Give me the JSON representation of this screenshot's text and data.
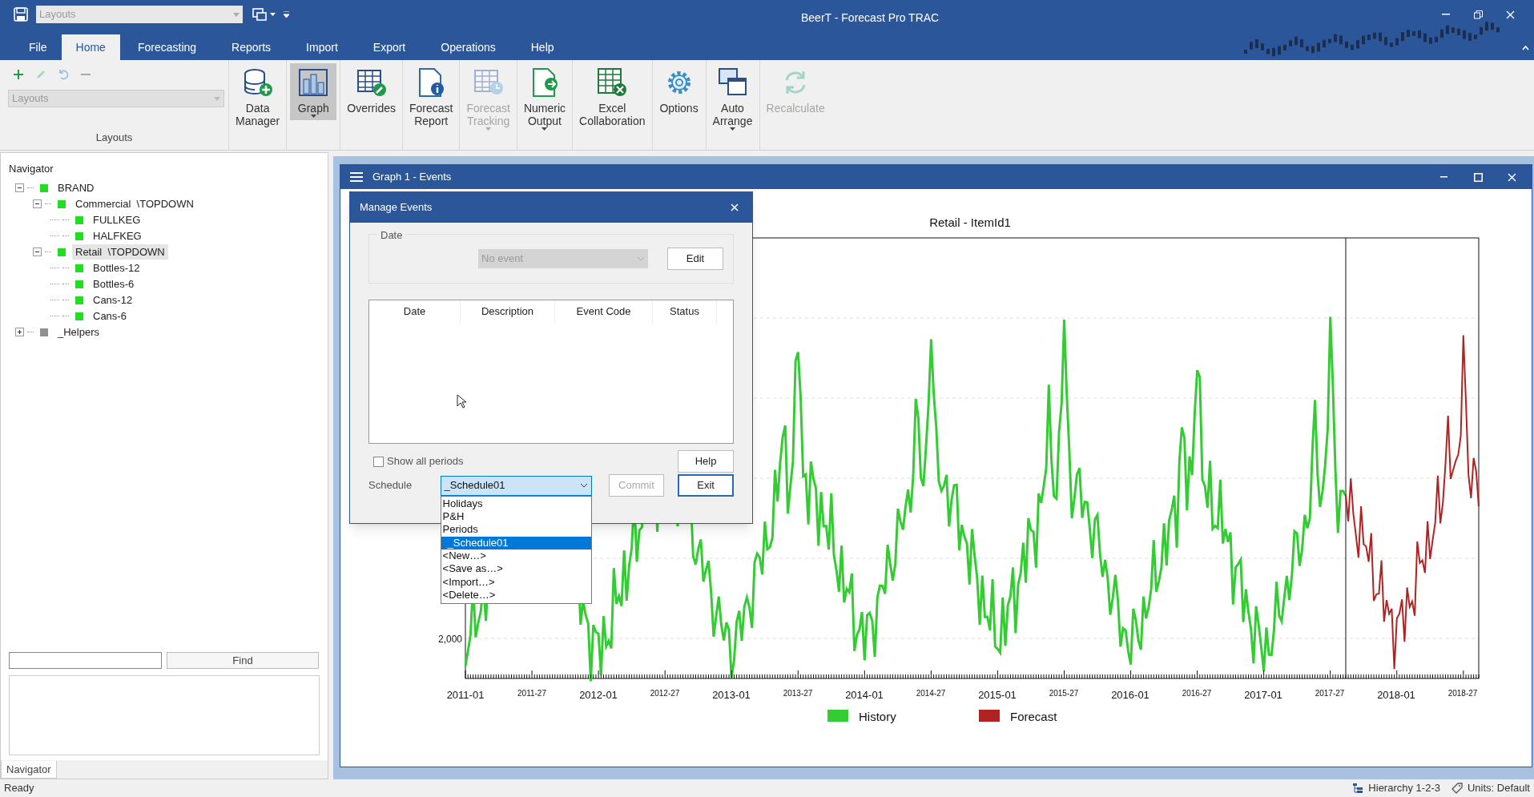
{
  "title_bar": {
    "layouts_combo": "Layouts",
    "title": "BeerT - Forecast Pro TRAC"
  },
  "ribbon_tabs": [
    {
      "label": "File",
      "selected": false
    },
    {
      "label": "Home",
      "selected": true
    },
    {
      "label": "Forecasting",
      "selected": false
    },
    {
      "label": "Reports",
      "selected": false
    },
    {
      "label": "Import",
      "selected": false
    },
    {
      "label": "Export",
      "selected": false
    },
    {
      "label": "Operations",
      "selected": false
    },
    {
      "label": "Help",
      "selected": false
    }
  ],
  "layouts_group": {
    "combo": "Layouts",
    "label": "Layouts"
  },
  "ribbon_buttons": [
    {
      "lines": [
        "Data",
        "Manager"
      ],
      "disabled": false,
      "selected": false,
      "has_menu": false
    },
    {
      "lines": [
        "Graph"
      ],
      "disabled": false,
      "selected": true,
      "has_menu": true
    },
    {
      "lines": [
        "Overrides"
      ],
      "disabled": false,
      "selected": false,
      "has_menu": false
    },
    {
      "lines": [
        "Forecast",
        "Report"
      ],
      "disabled": false,
      "selected": false,
      "has_menu": false
    },
    {
      "lines": [
        "Forecast",
        "Tracking"
      ],
      "disabled": true,
      "selected": false,
      "has_menu": true
    },
    {
      "lines": [
        "Numeric",
        "Output"
      ],
      "disabled": false,
      "selected": false,
      "has_menu": true
    },
    {
      "lines": [
        "Excel",
        "Collaboration"
      ],
      "disabled": false,
      "selected": false,
      "has_menu": false
    },
    {
      "lines": [
        "Options"
      ],
      "disabled": false,
      "selected": false,
      "has_menu": false
    },
    {
      "lines": [
        "Auto",
        "Arrange"
      ],
      "disabled": false,
      "selected": false,
      "has_menu": true
    },
    {
      "lines": [
        "Recalculate"
      ],
      "disabled": true,
      "selected": false,
      "has_menu": false
    }
  ],
  "navigator": {
    "title": "Navigator",
    "tree": [
      {
        "label": "BRAND",
        "color": "#22dd22",
        "expanded": true,
        "selected": false,
        "children": [
          {
            "label": "Commercial  \\TOPDOWN",
            "color": "#22dd22",
            "expanded": true,
            "selected": false,
            "children": [
              {
                "label": "FULLKEG",
                "color": "#22dd22",
                "selected": false
              },
              {
                "label": "HALFKEG",
                "color": "#22dd22",
                "selected": false
              }
            ]
          },
          {
            "label": "Retail  \\TOPDOWN",
            "color": "#22dd22",
            "expanded": true,
            "selected": true,
            "children": [
              {
                "label": "Bottles-12",
                "color": "#22dd22",
                "selected": false
              },
              {
                "label": "Bottles-6",
                "color": "#22dd22",
                "selected": false
              },
              {
                "label": "Cans-12",
                "color": "#22dd22",
                "selected": false
              },
              {
                "label": "Cans-6",
                "color": "#22dd22",
                "selected": false
              }
            ]
          }
        ]
      },
      {
        "label": "_Helpers",
        "color": "#909090",
        "expanded": false,
        "selected": false
      }
    ],
    "find_button": "Find",
    "tab": "Navigator"
  },
  "graph_window": {
    "title": "Graph 1 - Events"
  },
  "chart": {
    "title": "Retail - ItemId1",
    "y_label": "2,000",
    "x_labels": [
      {
        "label": "2011-01",
        "kind": "major"
      },
      {
        "label": "2011-27",
        "kind": "minor"
      },
      {
        "label": "2012-01",
        "kind": "major"
      },
      {
        "label": "2012-27",
        "kind": "minor"
      },
      {
        "label": "2013-01",
        "kind": "major"
      },
      {
        "label": "2013-27",
        "kind": "minor"
      },
      {
        "label": "2014-01",
        "kind": "major"
      },
      {
        "label": "2014-27",
        "kind": "minor"
      },
      {
        "label": "2015-01",
        "kind": "major"
      },
      {
        "label": "2015-27",
        "kind": "minor"
      },
      {
        "label": "2016-01",
        "kind": "major"
      },
      {
        "label": "2016-27",
        "kind": "minor"
      },
      {
        "label": "2017-01",
        "kind": "major"
      },
      {
        "label": "2017-27",
        "kind": "minor"
      },
      {
        "label": "2018-01",
        "kind": "major"
      },
      {
        "label": "2018-27",
        "kind": "minor"
      }
    ],
    "legend": [
      {
        "label": "History",
        "color": "#33cc33"
      },
      {
        "label": "Forecast",
        "color": "#b22222"
      }
    ]
  },
  "dialog": {
    "title": "Manage Events",
    "date_group": {
      "label": "Date",
      "combo": "No event",
      "combo_disabled": true,
      "edit_button": "Edit"
    },
    "columns": [
      "Date",
      "Description",
      "Event Code",
      "Status"
    ],
    "show_all": {
      "label": "Show all periods",
      "checked": false
    },
    "help_button": "Help",
    "schedule": {
      "label": "Schedule",
      "value": "_Schedule01",
      "options": [
        {
          "label": "Holidays",
          "selected": false
        },
        {
          "label": "P&H",
          "selected": false
        },
        {
          "label": "Periods",
          "selected": false
        },
        {
          "label": "_Schedule01",
          "selected": true
        },
        {
          "label": "<New…>",
          "selected": false
        },
        {
          "label": "<Save as…>",
          "selected": false
        },
        {
          "label": "<Import…>",
          "selected": false
        },
        {
          "label": "<Delete…>",
          "selected": false
        }
      ]
    },
    "commit_button": {
      "label": "Commit",
      "disabled": true
    },
    "exit_button": {
      "label": "Exit",
      "default": true
    }
  },
  "status_bar": {
    "state": "Ready",
    "hierarchy": "Hierarchy 1-2-3",
    "units": "Units: Default"
  }
}
